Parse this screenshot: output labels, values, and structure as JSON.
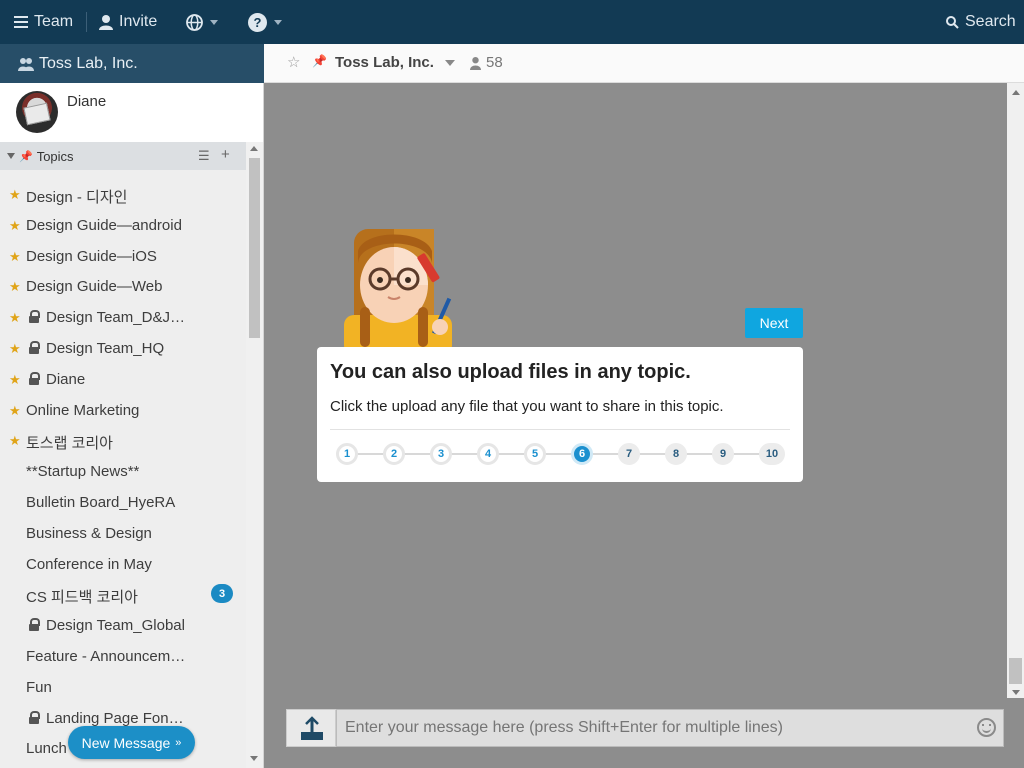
{
  "topbar": {
    "team_label": "Team",
    "invite_label": "Invite",
    "search_label": "Search",
    "icons": [
      "menu-icon",
      "user-icon",
      "globe-icon",
      "help-icon",
      "search-icon"
    ]
  },
  "sidebar": {
    "org_name": "Toss Lab, Inc.",
    "user_name": "Diane",
    "topics_header": "Topics",
    "topics": [
      {
        "label": "Design - 디자인",
        "starred": true,
        "locked": false
      },
      {
        "label": "Design Guide—android",
        "starred": true,
        "locked": false
      },
      {
        "label": "Design Guide—iOS",
        "starred": true,
        "locked": false
      },
      {
        "label": "Design Guide—Web",
        "starred": true,
        "locked": false
      },
      {
        "label": "Design Team_D&J…",
        "starred": true,
        "locked": true
      },
      {
        "label": "Design Team_HQ",
        "starred": true,
        "locked": true
      },
      {
        "label": "Diane",
        "starred": true,
        "locked": true
      },
      {
        "label": "Online Marketing",
        "starred": true,
        "locked": false
      },
      {
        "label": "토스랩 코리아",
        "starred": true,
        "locked": false
      },
      {
        "label": "**Startup News**",
        "starred": false,
        "locked": false
      },
      {
        "label": "Bulletin Board_HyeRA",
        "starred": false,
        "locked": false
      },
      {
        "label": "Business & Design",
        "starred": false,
        "locked": false
      },
      {
        "label": "Conference in May",
        "starred": false,
        "locked": false
      },
      {
        "label": "CS 피드백 코리아",
        "starred": false,
        "locked": false,
        "badge": "3"
      },
      {
        "label": "Design Team_Global",
        "starred": false,
        "locked": true
      },
      {
        "label": "Feature - Announcem…",
        "starred": false,
        "locked": false
      },
      {
        "label": "Fun",
        "starred": false,
        "locked": false
      },
      {
        "label": "Landing Page Fon…",
        "starred": false,
        "locked": true
      },
      {
        "label": "Lunch",
        "starred": false,
        "locked": false
      }
    ],
    "new_message_label": "New Message"
  },
  "main": {
    "title": "Toss Lab, Inc.",
    "member_count": "58",
    "composer_placeholder": "Enter your message here (press Shift+Enter for multiple lines)"
  },
  "tour": {
    "next_label": "Next",
    "title": "You can also upload files in any topic.",
    "body": "Click the upload any file that you want to share in this topic.",
    "steps": [
      "1",
      "2",
      "3",
      "4",
      "5",
      "6",
      "7",
      "8",
      "9",
      "10"
    ],
    "current_step": 6
  },
  "colors": {
    "topbar": "#123a54",
    "org_bar": "#274e68",
    "accent": "#0fa6e0",
    "star": "#e0a418",
    "badge": "#1b8ac3"
  }
}
